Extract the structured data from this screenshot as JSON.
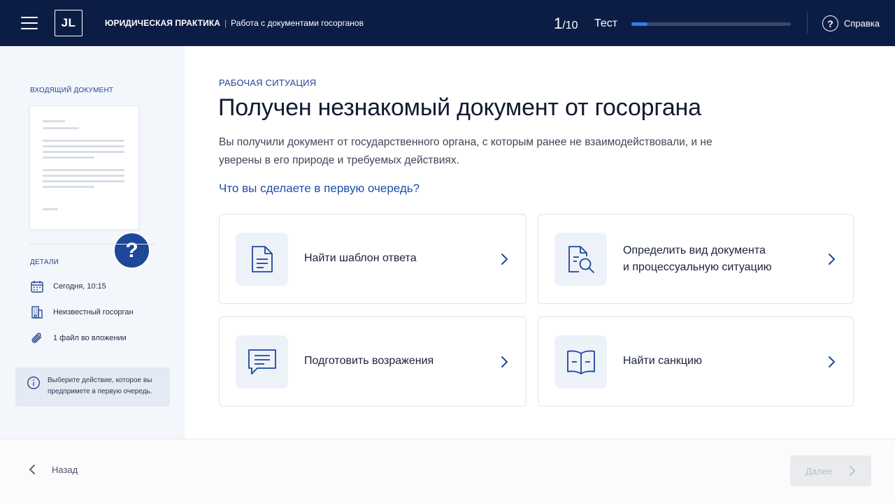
{
  "header": {
    "section": "ЮРИДИЧЕСКАЯ ПРАКТИКА",
    "separator": "|",
    "topic": "Работа с документами госорганов",
    "logo_text": "JL",
    "progress_current": "1",
    "progress_total": "/10",
    "progress_fraction": 0.1,
    "progress_label": "Тест",
    "help_label": "Справка",
    "help_glyph": "?"
  },
  "sidebar": {
    "incoming_title": "ВХОДЯЩИЙ ДОКУМЕНТ",
    "doc_badge": "?",
    "details_title": "ДЕТАЛИ",
    "details": [
      {
        "icon": "calendar-icon",
        "text": "Сегодня, 10:15"
      },
      {
        "icon": "building-icon",
        "text": "Неизвестный госорган"
      },
      {
        "icon": "paperclip-icon",
        "text": "1 файл во вложении"
      }
    ],
    "info_text": "Выберите действие, которое вы предпримете в первую очередь."
  },
  "main": {
    "eyebrow": "РАБОЧАЯ СИТУАЦИЯ",
    "title": "Получен незнакомый документ от госоргана",
    "lead": "Вы получили документ от государственного органа, с которым ранее не взаимодействовали, и не уверены в его природе и требуемых действиях.",
    "question": "Что вы сделаете в первую очередь?",
    "options": [
      {
        "icon": "document-icon",
        "label": "Найти шаблон ответа"
      },
      {
        "icon": "document-search-icon",
        "label_line1": "Определить вид документа",
        "label_line2": "и процессуальную ситуацию"
      },
      {
        "icon": "message-icon",
        "label": "Подготовить возражения"
      },
      {
        "icon": "book-icon",
        "label": "Найти санкцию"
      }
    ]
  },
  "footer": {
    "back_label": "Назад",
    "next_label": "Далее"
  },
  "colors": {
    "header_bg": "#0c1d45",
    "accent": "#1f4ea8",
    "progress": "#2f7ef0",
    "sidebar_bg": "#f3f6fb"
  }
}
